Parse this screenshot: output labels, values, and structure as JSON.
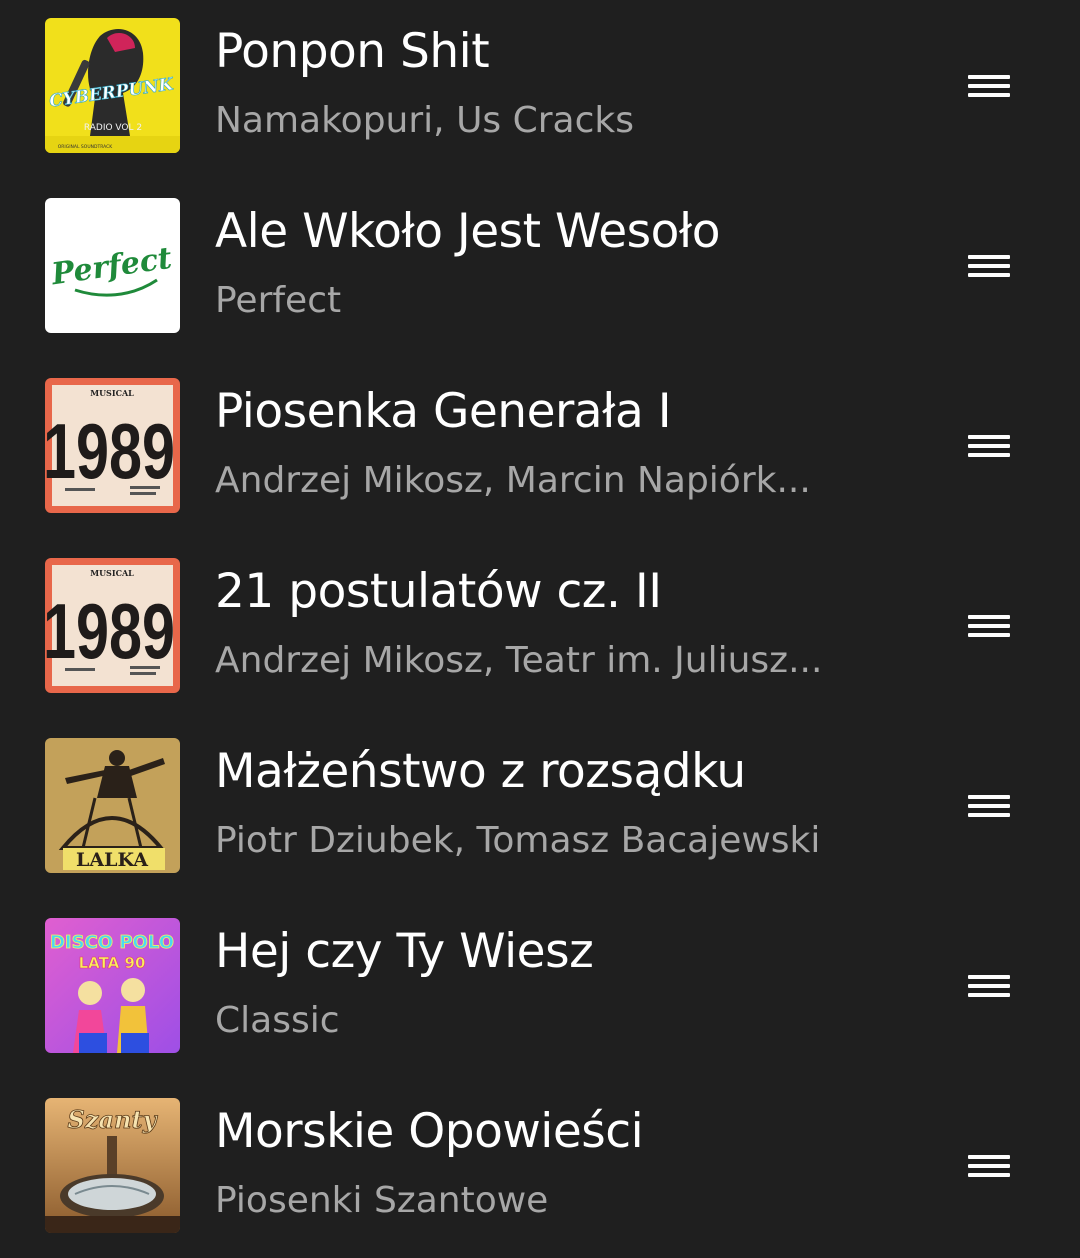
{
  "queue": {
    "tracks": [
      {
        "title": "Ponpon Shit",
        "artists": "Namakopuri, Us Cracks",
        "art_text": [
          "CYBERPUNK",
          "RADIO VOL 2",
          "ORIGINAL SOUNDTRACK"
        ],
        "art_color": "#f1e01b"
      },
      {
        "title": "Ale Wkoło Jest Wesoło",
        "artists": "Perfect",
        "art_text": [
          "Perfect"
        ],
        "art_color": "#ffffff"
      },
      {
        "title": "Piosenka Generała I",
        "artists": "Andrzej Mikosz, Marcin Napiórk...",
        "art_text": [
          "MUSICAL",
          "1989"
        ],
        "art_color": "#e8674a"
      },
      {
        "title": "21 postulatów cz. II",
        "artists": "Andrzej Mikosz, Teatr im. Juliusz...",
        "art_text": [
          "MUSICAL",
          "1989"
        ],
        "art_color": "#e8674a"
      },
      {
        "title": "Małżeństwo z rozsądku",
        "artists": "Piotr Dziubek, Tomasz Bacajewski",
        "art_text": [
          "LALKA"
        ],
        "art_color": "#c9a862"
      },
      {
        "title": "Hej czy Ty Wiesz",
        "artists": "Classic",
        "art_text": [
          "DISCO POLO",
          "LATA 90"
        ],
        "art_color": "#c45ee0"
      },
      {
        "title": "Morskie Opowieści",
        "artists": "Piosenki Szantowe",
        "art_text": [
          "Szanty"
        ],
        "art_color": "#c8874e"
      }
    ]
  },
  "icons": {
    "drag_handle": "drag-handle-icon"
  }
}
